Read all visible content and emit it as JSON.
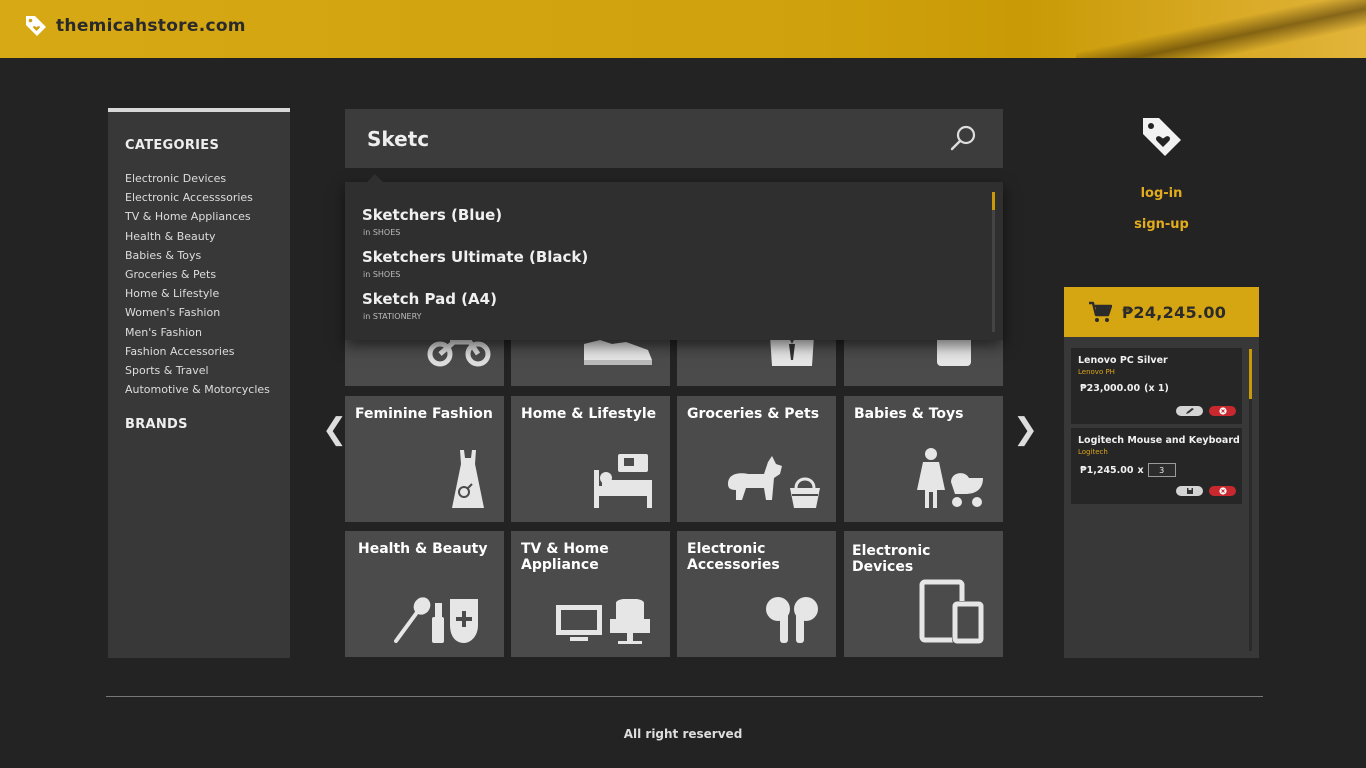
{
  "header": {
    "site_name": "themicahstore.com"
  },
  "sidebar": {
    "categories_title": "CATEGORIES",
    "categories": [
      "Electronic Devices",
      "Electronic Accesssories",
      "TV & Home Appliances",
      "Health & Beauty",
      "Babies & Toys",
      "Groceries & Pets",
      "Home & Lifestyle",
      "Women's Fashion",
      "Men's Fashion",
      "Fashion Accessories",
      "Sports & Travel",
      "Automotive & Motorcycles"
    ],
    "brands_title": "BRANDS"
  },
  "search": {
    "value": "Sketc"
  },
  "suggestions": [
    {
      "name": "Sketchers (Blue)",
      "category": "in SHOES"
    },
    {
      "name": "Sketchers Ultimate (Black)",
      "category": "in SHOES"
    },
    {
      "name": "Sketch Pad (A4)",
      "category": "in STATIONERY"
    }
  ],
  "tiles": [
    {
      "label": "Feminine Fashion",
      "icon": "dress-icon"
    },
    {
      "label": "Home & Lifestyle",
      "icon": "bed-icon"
    },
    {
      "label": "Groceries & Pets",
      "icon": "pets-basket-icon"
    },
    {
      "label": "Babies & Toys",
      "icon": "mother-stroller-icon"
    },
    {
      "label": "Health & Beauty",
      "icon": "beauty-icon"
    },
    {
      "label": "TV & Home Appliance",
      "icon": "tv-chair-icon"
    },
    {
      "label": "Electronic Accessories",
      "icon": "earbuds-icon"
    },
    {
      "label": "Electronic Devices",
      "icon": "devices-icon"
    }
  ],
  "nav": {
    "prev": "❮",
    "next": "❯"
  },
  "account": {
    "login": "log-in",
    "signup": "sign-up"
  },
  "cart": {
    "total": "₱24,245.00",
    "items": [
      {
        "name": "Lenovo PC Silver",
        "brand": "Lenovo PH",
        "price": "₱23,000.00",
        "qty_text": "(x 1)"
      },
      {
        "name": "Logitech Mouse and Keyboard",
        "brand": "Logitech",
        "price": "₱1,245.00",
        "qty_prefix": "x",
        "qty_value": "3"
      }
    ]
  },
  "footer": {
    "text": "All right reserved"
  },
  "colors": {
    "accent": "#d6a512",
    "background": "#232323",
    "panel": "#383838",
    "tile": "#4b4b4b",
    "delete": "#c8282e"
  }
}
